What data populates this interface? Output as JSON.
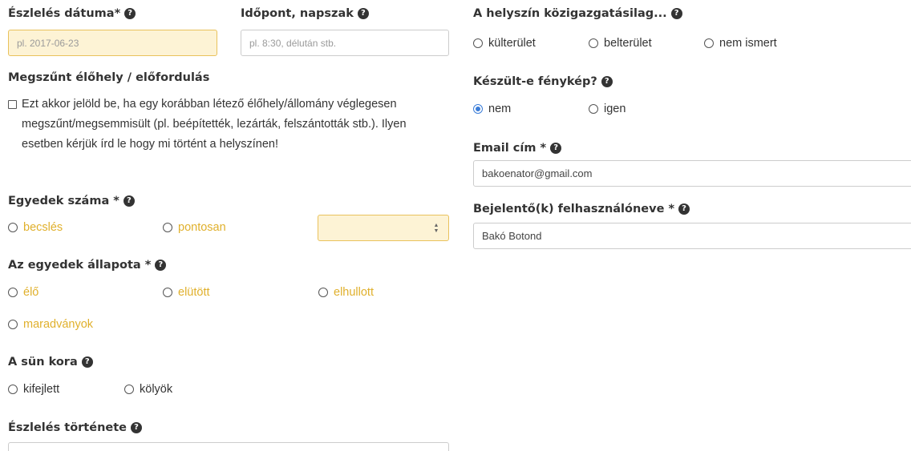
{
  "help_glyph": "?",
  "date": {
    "label": "Észlelés dátuma*",
    "placeholder": "pl. 2017-06-23"
  },
  "time": {
    "label": "Időpont, napszak",
    "placeholder": "pl. 8:30, délután stb."
  },
  "extinct": {
    "label": "Megszűnt élőhely / előfordulás",
    "text": "Ezt akkor jelöld be, ha egy korábban létező élőhely/állomány véglegesen megszűnt/megsemmisült (pl. beépítették, lezárták, felszántották stb.). Ilyen esetben kérjük írd le hogy mi történt a helyszínen!"
  },
  "count": {
    "label": "Egyedek száma *",
    "options": [
      "becslés",
      "pontosan"
    ]
  },
  "state": {
    "label": "Az egyedek állapota *",
    "options": [
      "élő",
      "elütött",
      "elhullott",
      "maradványok"
    ]
  },
  "age": {
    "label": "A sün kora",
    "options": [
      "kifejlett",
      "kölyök"
    ]
  },
  "history": {
    "label": "Észlelés története"
  },
  "location": {
    "label": "A helyszín közigazgatásilag...",
    "options": [
      "külterület",
      "belterület",
      "nem ismert"
    ]
  },
  "photo": {
    "label": "Készült-e fénykép?",
    "options": [
      "nem",
      "igen"
    ],
    "selected": "nem"
  },
  "email": {
    "label": "Email cím *",
    "value": "bakoenator@gmail.com"
  },
  "reporter": {
    "label": "Bejelentő(k) felhasználóneve *",
    "value": "Bakó Botond"
  },
  "colors": {
    "warn_text": "#e0b02c",
    "warn_bg": "#fdf3d5",
    "warn_border": "#e9c25c",
    "radio_selected": "#3b7dd8"
  },
  "icons": {
    "help": "help-icon",
    "checkbox": "checkbox-icon",
    "spinner": "spinner-icon"
  }
}
